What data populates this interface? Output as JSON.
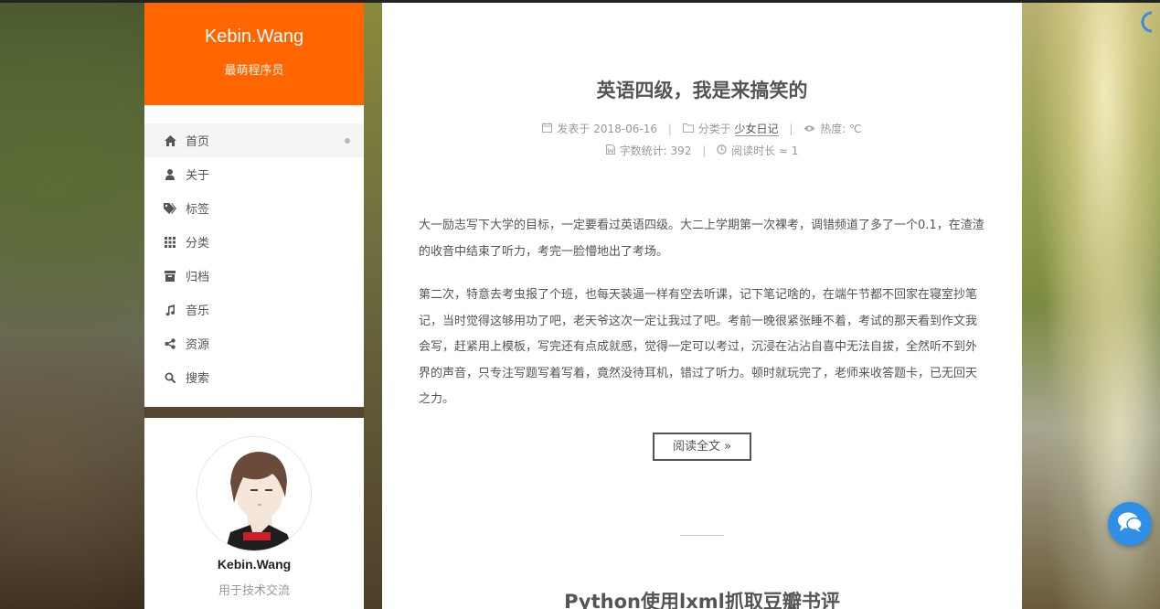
{
  "site": {
    "title": "Kebin.Wang",
    "subtitle": "最萌程序员"
  },
  "menu": [
    {
      "label": "首页",
      "icon": "home-icon",
      "active": true
    },
    {
      "label": "关于",
      "icon": "user-icon"
    },
    {
      "label": "标签",
      "icon": "tags-icon"
    },
    {
      "label": "分类",
      "icon": "grid-icon"
    },
    {
      "label": "归档",
      "icon": "archive-icon"
    },
    {
      "label": "音乐",
      "icon": "music-icon"
    },
    {
      "label": "资源",
      "icon": "share-icon"
    },
    {
      "label": "搜索",
      "icon": "search-icon"
    }
  ],
  "profile": {
    "name": "Kebin.Wang",
    "description": "用于技术交流"
  },
  "post": {
    "title": "英语四级，我是来搞笑的",
    "meta": {
      "posted_label": "发表于",
      "posted_date": "2018-06-16",
      "category_label": "分类于",
      "category": "少女日记",
      "heat_label": "热度: ℃",
      "wordcount_label": "字数统计: 392",
      "readtime_label": "阅读时长 ≈ 1"
    },
    "paragraphs": [
      "大一励志写下大学的目标，一定要看过英语四级。大二上学期第一次裸考，调错频道了多了一个0.1，在渣渣的收音中结束了听力，考完一脸懵地出了考场。",
      "第二次，特意去考虫报了个班，也每天装逼一样有空去听课，记下笔记啥的，在端午节都不回家在寝室抄笔记，当时觉得这够用功了吧，老天爷这次一定让我过了吧。考前一晚很紧张睡不着，考试的那天看到作文我会写，赶紧用上模板，写完还有点成就感，觉得一定可以考过，沉浸在沾沾自喜中无法自拔，全然听不到外界的声音，只专注写题写着写着，竟然没待耳机，错过了听力。顿时就玩完了，老师来收答题卡，已无回天之力。"
    ],
    "read_more": "阅读全文 »"
  },
  "next_post": {
    "title": "Python使用lxml抓取豆瓣书评"
  },
  "colors": {
    "brand": "#ff6600",
    "chat": "#2f8ee5"
  }
}
